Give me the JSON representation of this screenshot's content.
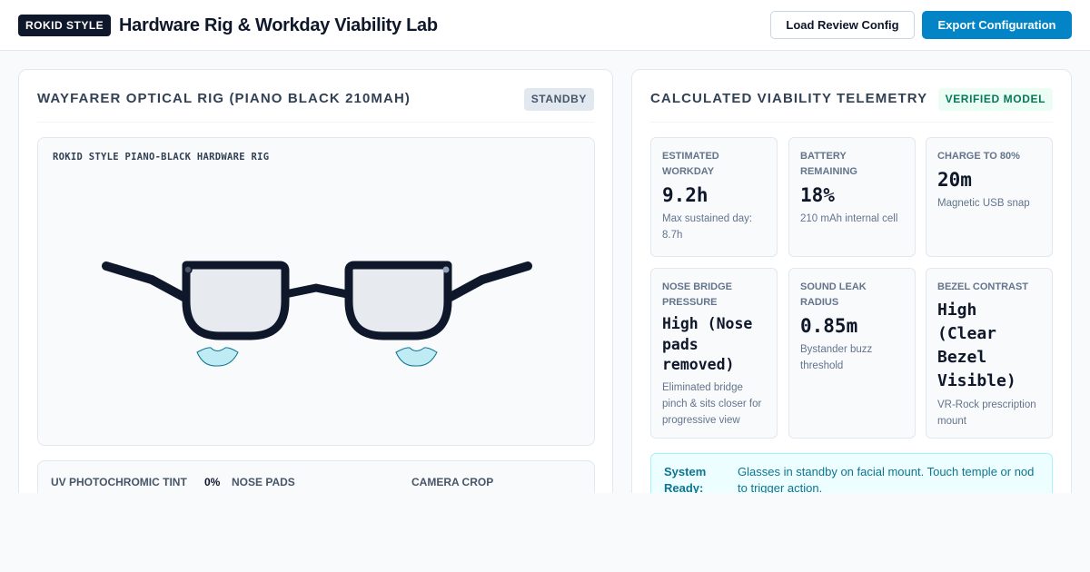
{
  "header": {
    "brand_badge": "ROKID STYLE",
    "title": "Hardware Rig & Workday Viability Lab",
    "load_button": "Load Review Config",
    "export_button": "Export Configuration"
  },
  "rig_panel": {
    "title": "WAYFARER OPTICAL RIG (PIANO BLACK 210MAH)",
    "status_tag": "STANDBY",
    "preview_label": "ROKID STYLE PIANO-BLACK HARDWARE RIG",
    "controls": [
      {
        "label": "UV PHOTOCHROMIC TINT",
        "value": "0%"
      },
      {
        "label": "NOSE PADS",
        "value": ""
      },
      {
        "label": "CAMERA CROP",
        "value": ""
      }
    ]
  },
  "telemetry_panel": {
    "title": "CALCULATED VIABILITY TELEMETRY",
    "status_tag": "VERIFIED MODEL",
    "cards": [
      {
        "label": "ESTIMATED WORKDAY",
        "value": "9.2h",
        "sub": "Max sustained day: 8.7h"
      },
      {
        "label": "BATTERY REMAINING",
        "value": "18%",
        "sub": "210 mAh internal cell"
      },
      {
        "label": "CHARGE TO 80%",
        "value": "20m",
        "sub": "Magnetic USB snap"
      },
      {
        "label": "NOSE BRIDGE PRESSURE",
        "value": "High (Nose pads removed)",
        "sub": "Eliminated bridge pinch & sits closer for progressive view"
      },
      {
        "label": "SOUND LEAK RADIUS",
        "value": "0.85m",
        "sub": "Bystander buzz threshold"
      },
      {
        "label": "BEZEL CONTRAST",
        "value": "High (Clear Bezel Visible)",
        "sub": "VR-Rock prescription mount"
      }
    ],
    "status": {
      "label": "System Ready:",
      "text": "Glasses in standby on facial mount. Touch temple or nod to trigger action."
    }
  },
  "colors": {
    "brand_dark": "#0f172a",
    "accent_blue": "#0284c7",
    "verified_green": "#047857",
    "status_cyan": "#0e7490",
    "nose_pad_cyan": "#a5e8f0"
  }
}
